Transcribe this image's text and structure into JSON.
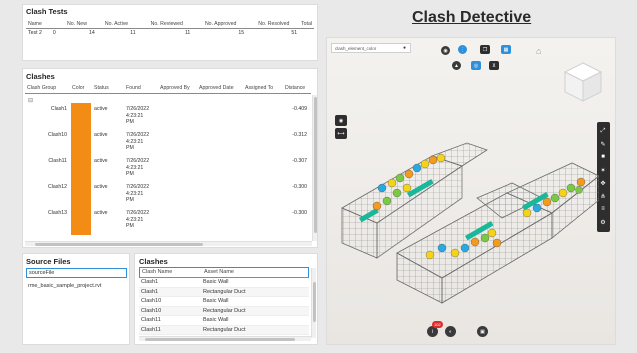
{
  "report_title": "Clash Detective",
  "clash_tests": {
    "title": "Clash Tests",
    "columns": [
      "Name",
      "No. New",
      "No. Active",
      "No. Reviewed",
      "No. Approved",
      "No. Resolved",
      "Total"
    ],
    "rows": [
      [
        "Test 2",
        "0",
        "14",
        "11",
        "11",
        "15",
        "51"
      ]
    ]
  },
  "clashes": {
    "title": "Clashes",
    "columns": [
      "Clash Group",
      "Color",
      "Status",
      "Found",
      "Approved By",
      "Approved Date",
      "Assigned To",
      "Distance"
    ],
    "group_toggle": "⊟",
    "color_swatch": "#f28c15",
    "rows": [
      {
        "group": "Clash1",
        "status": "active",
        "found": [
          "7/26/2022",
          "4:23:21",
          "PM"
        ],
        "distance": "-0.409"
      },
      {
        "group": "Clash10",
        "status": "active",
        "found": [
          "7/26/2022",
          "4:23:21",
          "PM"
        ],
        "distance": "-0.312"
      },
      {
        "group": "Clash11",
        "status": "active",
        "found": [
          "7/26/2022",
          "4:23:21",
          "PM"
        ],
        "distance": "-0.307"
      },
      {
        "group": "Clash12",
        "status": "active",
        "found": [
          "7/26/2022",
          "4:23:21",
          "PM"
        ],
        "distance": "-0.300"
      },
      {
        "group": "Clash13",
        "status": "active",
        "found": [
          "7/26/2022",
          "4:23:21",
          "PM"
        ],
        "distance": "-0.300"
      }
    ]
  },
  "source_files": {
    "title": "Source Files",
    "column": "sourceFile",
    "rows": [
      "rme_basic_sample_project.rvt"
    ]
  },
  "clashes_assets": {
    "title": "Clashes",
    "columns": [
      "Clash Name",
      "Asset Name"
    ],
    "rows": [
      [
        "Clash1",
        "Basic Wall"
      ],
      [
        "Clash1",
        "Rectangular Duct"
      ],
      [
        "Clash10",
        "Basic Wall"
      ],
      [
        "Clash10",
        "Rectangular Duct"
      ],
      [
        "Clash11",
        "Basic Wall"
      ],
      [
        "Clash11",
        "Rectangular Duct"
      ]
    ]
  },
  "viewer": {
    "dropdown_value": "clash_element_color",
    "badge_count": "102"
  },
  "colors": {
    "accent_blue": "#2f8fd8",
    "clash_orange": "#f28c15",
    "toolbar_dark": "#2e2e2e",
    "badge_red": "#e02a2a"
  },
  "icons": [
    "dropdown-pin-icon",
    "camera-icon",
    "hierarchy-icon",
    "copy-icon",
    "grid-icon",
    "upload-icon",
    "focus-icon",
    "filter-icon",
    "home-icon",
    "eye-icon",
    "measure-icon",
    "expand-icon",
    "pen-icon",
    "cube-icon",
    "explode-icon",
    "move-icon",
    "tree-icon",
    "settings-icon",
    "layers-icon",
    "info-icon",
    "save-icon"
  ]
}
